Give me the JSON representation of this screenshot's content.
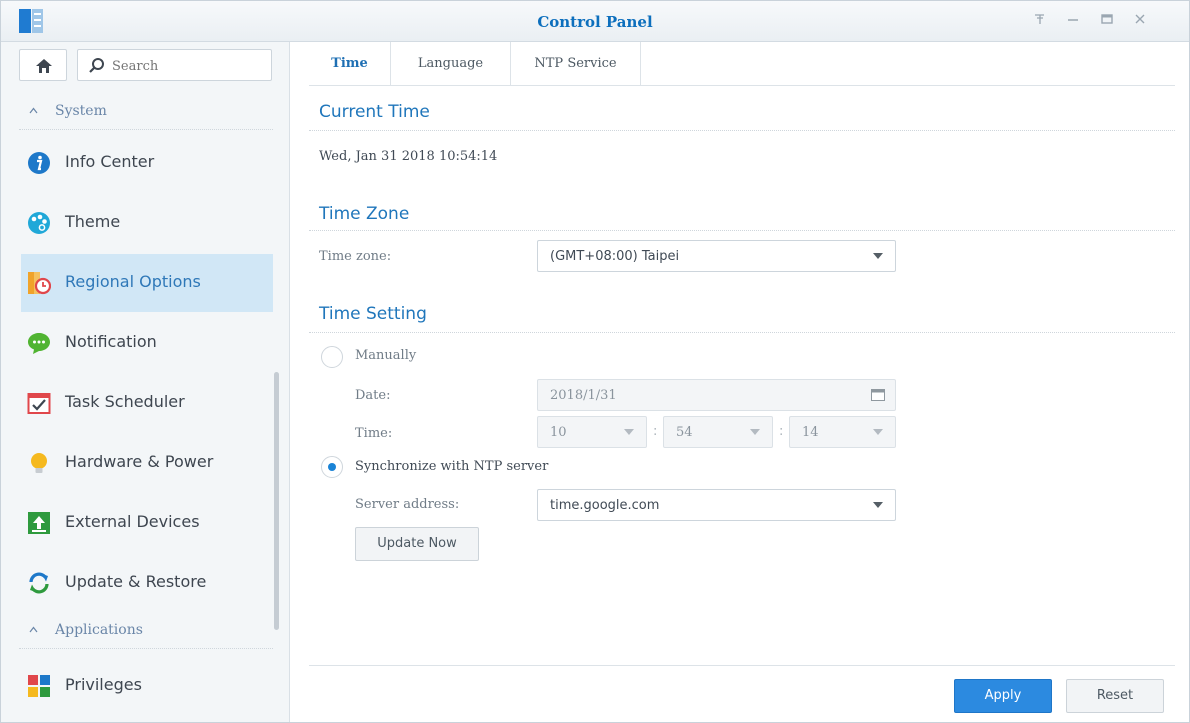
{
  "window": {
    "title": "Control Panel",
    "controls": [
      "help-icon",
      "minimize-icon",
      "maximize-icon",
      "close-icon"
    ]
  },
  "sidebar": {
    "search_placeholder": "Search",
    "groups": [
      {
        "label": "System"
      },
      {
        "label": "Applications"
      }
    ],
    "items": [
      {
        "label": "Info Center",
        "icon": "info-icon"
      },
      {
        "label": "Theme",
        "icon": "palette-icon"
      },
      {
        "label": "Regional Options",
        "icon": "regional-options-icon",
        "active": true
      },
      {
        "label": "Notification",
        "icon": "chat-bubble-icon"
      },
      {
        "label": "Task Scheduler",
        "icon": "calendar-check-icon"
      },
      {
        "label": "Hardware & Power",
        "icon": "lightbulb-icon"
      },
      {
        "label": "External Devices",
        "icon": "upload-icon"
      },
      {
        "label": "Update & Restore",
        "icon": "refresh-icon"
      },
      {
        "label": "Privileges",
        "icon": "privileges-grid-icon"
      }
    ]
  },
  "tabs": [
    {
      "label": "Time",
      "active": true
    },
    {
      "label": "Language"
    },
    {
      "label": "NTP Service"
    }
  ],
  "current_time": {
    "heading": "Current Time",
    "value": "Wed, Jan 31 2018 10:54:14"
  },
  "time_zone": {
    "heading": "Time Zone",
    "label": "Time zone:",
    "value": "(GMT+08:00) Taipei"
  },
  "time_setting": {
    "heading": "Time Setting",
    "manually_label": "Manually",
    "date_label": "Date:",
    "date_value": "2018/1/31",
    "time_label": "Time:",
    "hour": "10",
    "minute": "54",
    "second": "14",
    "ntp_label": "Synchronize with NTP server",
    "server_label": "Server address:",
    "server_value": "time.google.com",
    "update_button": "Update Now",
    "selected_mode": "ntp"
  },
  "footer": {
    "apply": "Apply",
    "reset": "Reset"
  },
  "colors": {
    "accent": "#1f76bb",
    "active_bg": "#d1e7f6",
    "primary_button": "#2c8ae0"
  }
}
